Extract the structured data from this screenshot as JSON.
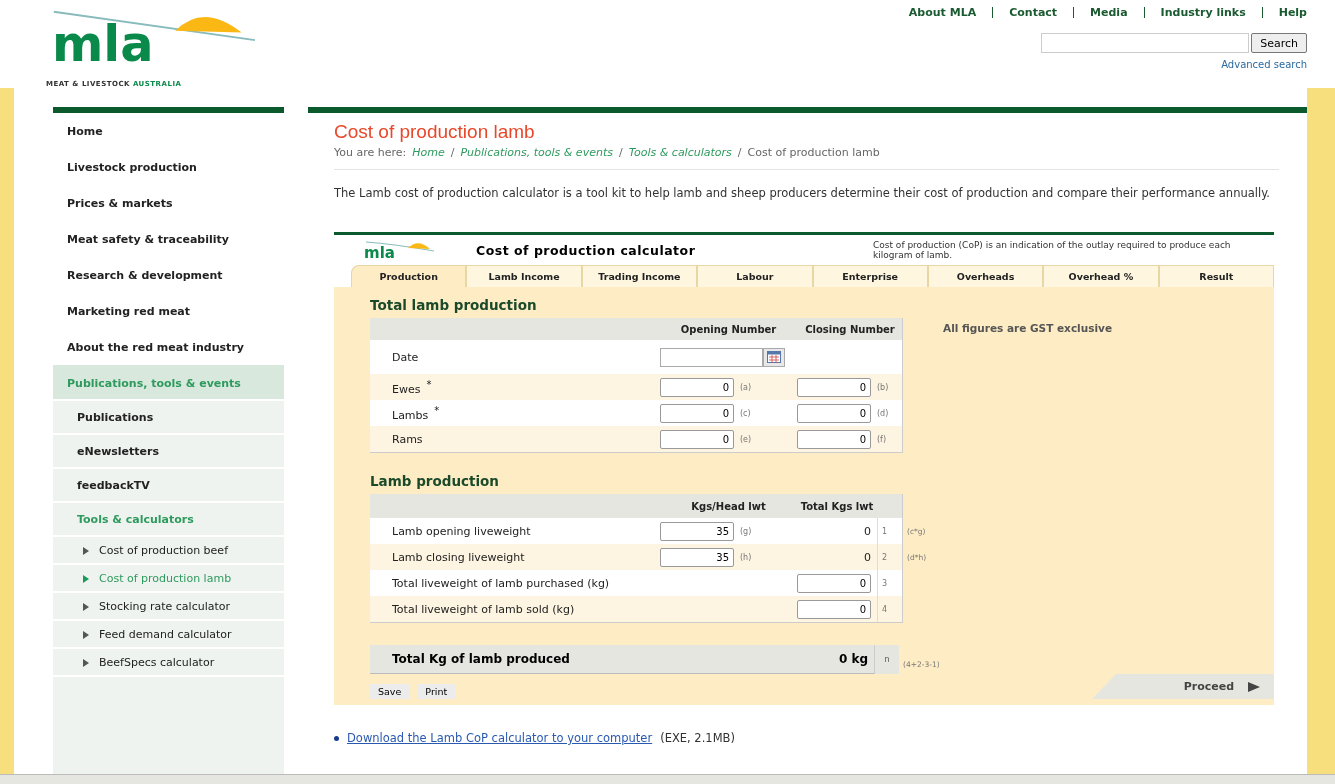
{
  "header": {
    "logo": {
      "wordmark": "mla",
      "tagline_dark": "MEAT & LIVESTOCK",
      "tagline_light": "AUSTRALIA"
    },
    "top_links": [
      "About MLA",
      "Contact",
      "Media",
      "Industry links",
      "Help"
    ],
    "search": {
      "button": "Search",
      "advanced": "Advanced search"
    }
  },
  "sidebar": {
    "items": [
      {
        "label": "Home",
        "selected": false
      },
      {
        "label": "Livestock production",
        "selected": false
      },
      {
        "label": "Prices & markets",
        "selected": false
      },
      {
        "label": "Meat safety & traceability",
        "selected": false
      },
      {
        "label": "Research & development",
        "selected": false
      },
      {
        "label": "Marketing red meat",
        "selected": false
      },
      {
        "label": "About the red meat industry",
        "selected": false
      },
      {
        "label": "Publications, tools & events",
        "selected": true,
        "children": [
          {
            "label": "Publications",
            "selected": false
          },
          {
            "label": "eNewsletters",
            "selected": false
          },
          {
            "label": "feedbackTV",
            "selected": false
          },
          {
            "label": "Tools & calculators",
            "selected": true,
            "children": [
              {
                "label": "Cost of production beef",
                "selected": false
              },
              {
                "label": "Cost of production lamb",
                "selected": true
              },
              {
                "label": "Stocking rate calculator",
                "selected": false
              },
              {
                "label": "Feed demand calculator",
                "selected": false
              },
              {
                "label": "BeefSpecs calculator",
                "selected": false
              }
            ]
          }
        ]
      }
    ]
  },
  "page": {
    "title": "Cost of production lamb",
    "breadcrumb": {
      "prefix": "You are here:",
      "links": [
        "Home",
        "Publications, tools & events",
        "Tools & calculators"
      ],
      "separator": "/",
      "current": "Cost of production lamb"
    },
    "intro": "The Lamb cost of production calculator is a tool kit to help lamb and sheep producers determine their cost of production and compare their performance annually.",
    "download": {
      "link": "Download the Lamb CoP calculator to your computer",
      "info": "(EXE, 2.1MB)"
    }
  },
  "calculator": {
    "logo": "mla",
    "title": "Cost of production calculator",
    "note": "Cost of production (CoP) is an indication of the outlay required to produce each kilogram of lamb.",
    "tabs": [
      {
        "label": "Production",
        "selected": true
      },
      {
        "label": "Lamb Income",
        "selected": false
      },
      {
        "label": "Trading Income",
        "selected": false
      },
      {
        "label": "Labour",
        "selected": false
      },
      {
        "label": "Enterprise",
        "selected": false
      },
      {
        "label": "Overheads",
        "selected": false
      },
      {
        "label": "Overhead %",
        "selected": false
      },
      {
        "label": "Result",
        "selected": false
      }
    ],
    "gst_note": "All figures are GST exclusive",
    "sections": [
      {
        "title": "Total lamb production",
        "columns": [
          "Opening Number",
          "Closing Number"
        ],
        "rows": [
          {
            "kind": "date",
            "label": "Date"
          },
          {
            "kind": "pair",
            "label": "Ewes",
            "marker": "*",
            "inputs": [
              {
                "value": "0",
                "code": "(a)"
              },
              {
                "value": "0",
                "code": "(b)"
              }
            ]
          },
          {
            "kind": "pair",
            "label": "Lambs",
            "marker": "*",
            "inputs": [
              {
                "value": "0",
                "code": "(c)"
              },
              {
                "value": "0",
                "code": "(d)"
              }
            ]
          },
          {
            "kind": "pair",
            "label": "Rams",
            "inputs": [
              {
                "value": "0",
                "code": "(e)"
              },
              {
                "value": "0",
                "code": "(f)"
              }
            ]
          }
        ]
      },
      {
        "title": "Lamb production",
        "columns": [
          "Kgs/Head lwt",
          "Total Kgs lwt"
        ],
        "rows": [
          {
            "kind": "weight",
            "label": "Lamb opening liveweight",
            "input": {
              "value": "35",
              "code": "(g)"
            },
            "total": "0",
            "line": "1",
            "formula": "(c*g)"
          },
          {
            "kind": "weight",
            "label": "Lamb closing liveweight",
            "input": {
              "value": "35",
              "code": "(h)"
            },
            "total": "0",
            "line": "2",
            "formula": "(d*h)"
          },
          {
            "kind": "amount",
            "label": "Total liveweight of lamb purchased (kg)",
            "value": "0",
            "line": "3"
          },
          {
            "kind": "amount",
            "label": "Total liveweight of lamb sold (kg)",
            "value": "0",
            "line": "4"
          }
        ]
      }
    ],
    "total": {
      "label": "Total Kg of lamb produced",
      "value": "0 kg",
      "ref": "n",
      "formula": "(4+2-3-1)"
    },
    "buttons": [
      "Save",
      "Print"
    ],
    "proceed": "Proceed"
  }
}
